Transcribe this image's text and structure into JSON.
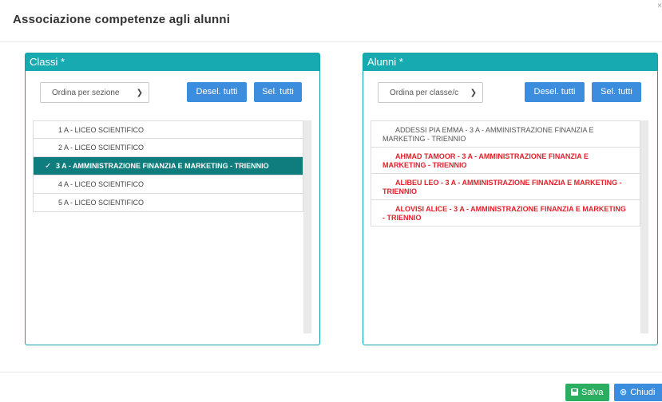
{
  "dialog": {
    "title": "Associazione competenze agli alunni",
    "close": "×"
  },
  "classi": {
    "header": "Classi *",
    "sort_select": "Ordina per sezione",
    "deselect_label": "Desel. tutti",
    "select_label": "Sel. tutti",
    "items": [
      {
        "label": "1 A - LICEO SCIENTIFICO",
        "selected": false
      },
      {
        "label": "2 A - LICEO SCIENTIFICO",
        "selected": false
      },
      {
        "label": "3 A - AMMINISTRAZIONE FINANZIA E MARKETING - TRIENNIO",
        "selected": true
      },
      {
        "label": "4 A - LICEO SCIENTIFICO",
        "selected": false
      },
      {
        "label": "5 A - LICEO SCIENTIFICO",
        "selected": false
      }
    ],
    "check_glyph": "✓"
  },
  "alunni": {
    "header": "Alunni *",
    "sort_select": "Ordina per classe/c",
    "deselect_label": "Desel. tutti",
    "select_label": "Sel. tutti",
    "items": [
      {
        "label": "ADDESSI PIA EMMA - 3 A - AMMINISTRAZIONE FINANZIA E MARKETING - TRIENNIO",
        "highlight": false
      },
      {
        "label": "AHMAD TAMOOR - 3 A - AMMINISTRAZIONE FINANZIA E MARKETING - TRIENNIO",
        "highlight": true
      },
      {
        "label": "ALIBEU LEO - 3 A - AMMINISTRAZIONE FINANZIA E MARKETING - TRIENNIO",
        "highlight": true
      },
      {
        "label": "ALOVISI ALICE - 3 A - AMMINISTRAZIONE FINANZIA E MARKETING - TRIENNIO",
        "highlight": true
      }
    ]
  },
  "footer": {
    "save_label": "Salva",
    "close_label": "Chiudi",
    "close_icon_glyph": "⊗"
  },
  "colors": {
    "panel_header": "#17aab1",
    "selected_row": "#0f7d7d",
    "button_blue": "#3c8dde",
    "button_green": "#2bae5f",
    "highlight_text": "#e0212b"
  }
}
